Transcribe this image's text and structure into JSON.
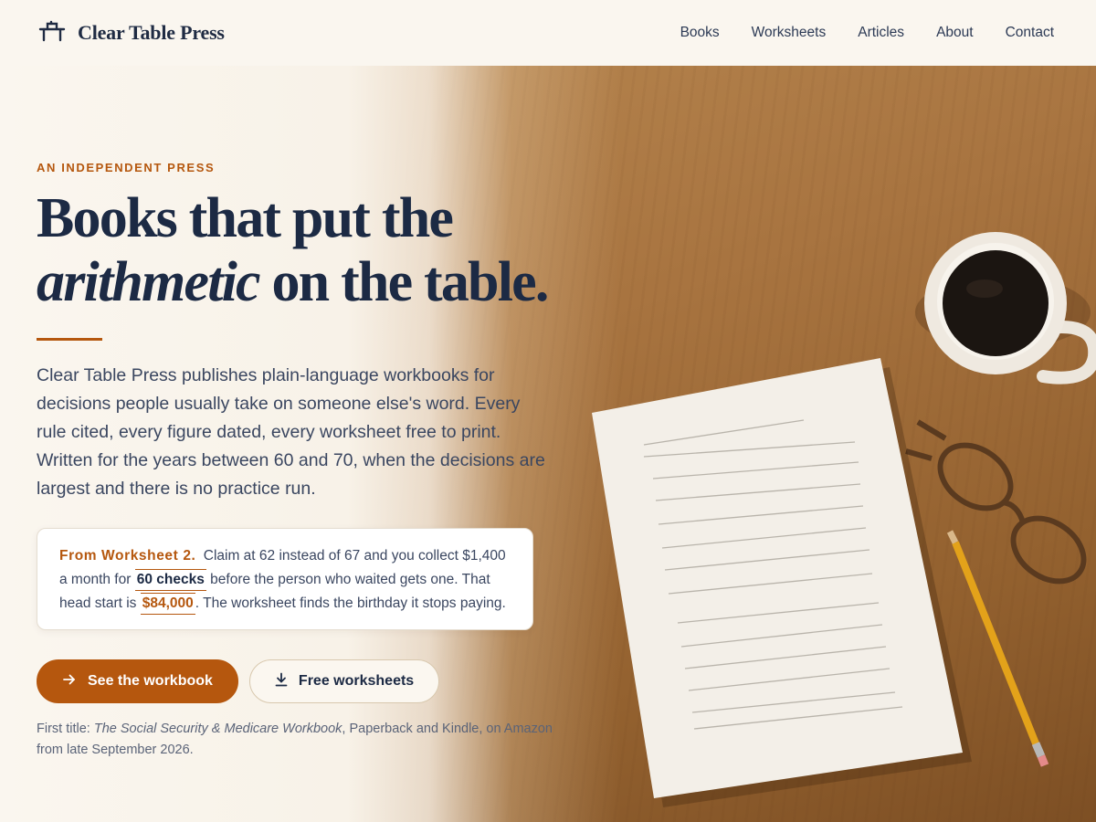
{
  "brand": {
    "name": "Clear Table Press",
    "logo_icon": "table-icon"
  },
  "nav": {
    "items": [
      "Books",
      "Worksheets",
      "Articles",
      "About",
      "Contact"
    ]
  },
  "hero": {
    "eyebrow": "AN INDEPENDENT PRESS",
    "headline_line1": "Books that put the",
    "headline_italic": "arithmetic",
    "headline_rest": " on the table.",
    "lede": "Clear Table Press publishes plain-language workbooks for decisions people usually take on someone else's word. Every rule cited, every figure dated, every worksheet free to print. Written for the years between 60 and 70, when the decisions are largest and there is no practice run.",
    "callout": {
      "label": "From Worksheet 2.",
      "text_1": " Claim at 62 instead of 67 and you collect $1,400 a month for ",
      "checks": "60 checks",
      "text_2": " before the person who waited gets one. That head start is ",
      "amount": "$84,000",
      "text_3": ". The worksheet finds the birthday it stops paying."
    },
    "primary_button": {
      "label": "See the workbook",
      "icon": "arrow-right-icon"
    },
    "secondary_button": {
      "label": "Free worksheets",
      "icon": "download-icon"
    },
    "footnote": {
      "prefix": "First title: ",
      "title": "The Social Security & Medicare Workbook",
      "suffix": ", Paperback and Kindle, on Amazon from late September 2026."
    }
  },
  "colors": {
    "accent": "#b5570e",
    "ink": "#1c2a44",
    "background": "#faf6ef"
  }
}
